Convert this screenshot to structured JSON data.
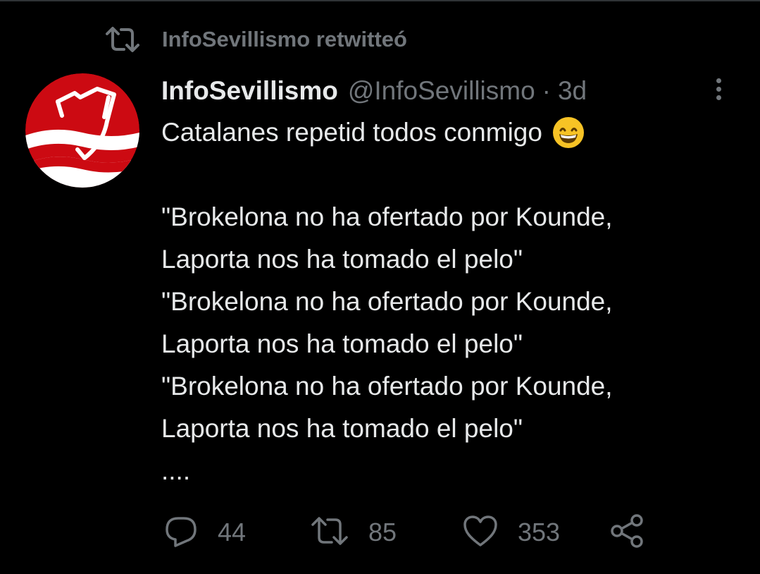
{
  "retweet_header": {
    "icon": "retweet-icon",
    "label": "InfoSevillismo retwitteó"
  },
  "tweet": {
    "avatar": {
      "icon": "sevilla-crest-avatar",
      "colors": {
        "background": "#cc0a12",
        "stripe": "#ffffff"
      }
    },
    "display_name": "InfoSevillismo",
    "handle": "@InfoSevillismo",
    "separator": "·",
    "time": "3d",
    "more_icon": "more-vertical-icon",
    "lines": [
      "Catalanes repetid todos conmigo",
      "",
      "\"Brokelona no ha ofertado por Kounde,",
      "Laporta nos ha tomado el pelo\"",
      "\"Brokelona no ha ofertado por Kounde,",
      "Laporta nos ha tomado el pelo\"",
      "\"Brokelona no ha ofertado por Kounde,",
      "Laporta nos ha tomado el pelo\"",
      "...."
    ],
    "emoji": "grinning-face-emoji",
    "actions": {
      "reply": {
        "icon": "reply-icon",
        "count": "44"
      },
      "retweet": {
        "icon": "retweet-icon",
        "count": "85"
      },
      "like": {
        "icon": "heart-icon",
        "count": "353"
      },
      "share": {
        "icon": "share-icon"
      }
    }
  },
  "colors": {
    "background": "#000000",
    "text": "#e7e9ea",
    "secondary_text": "#71767b"
  }
}
